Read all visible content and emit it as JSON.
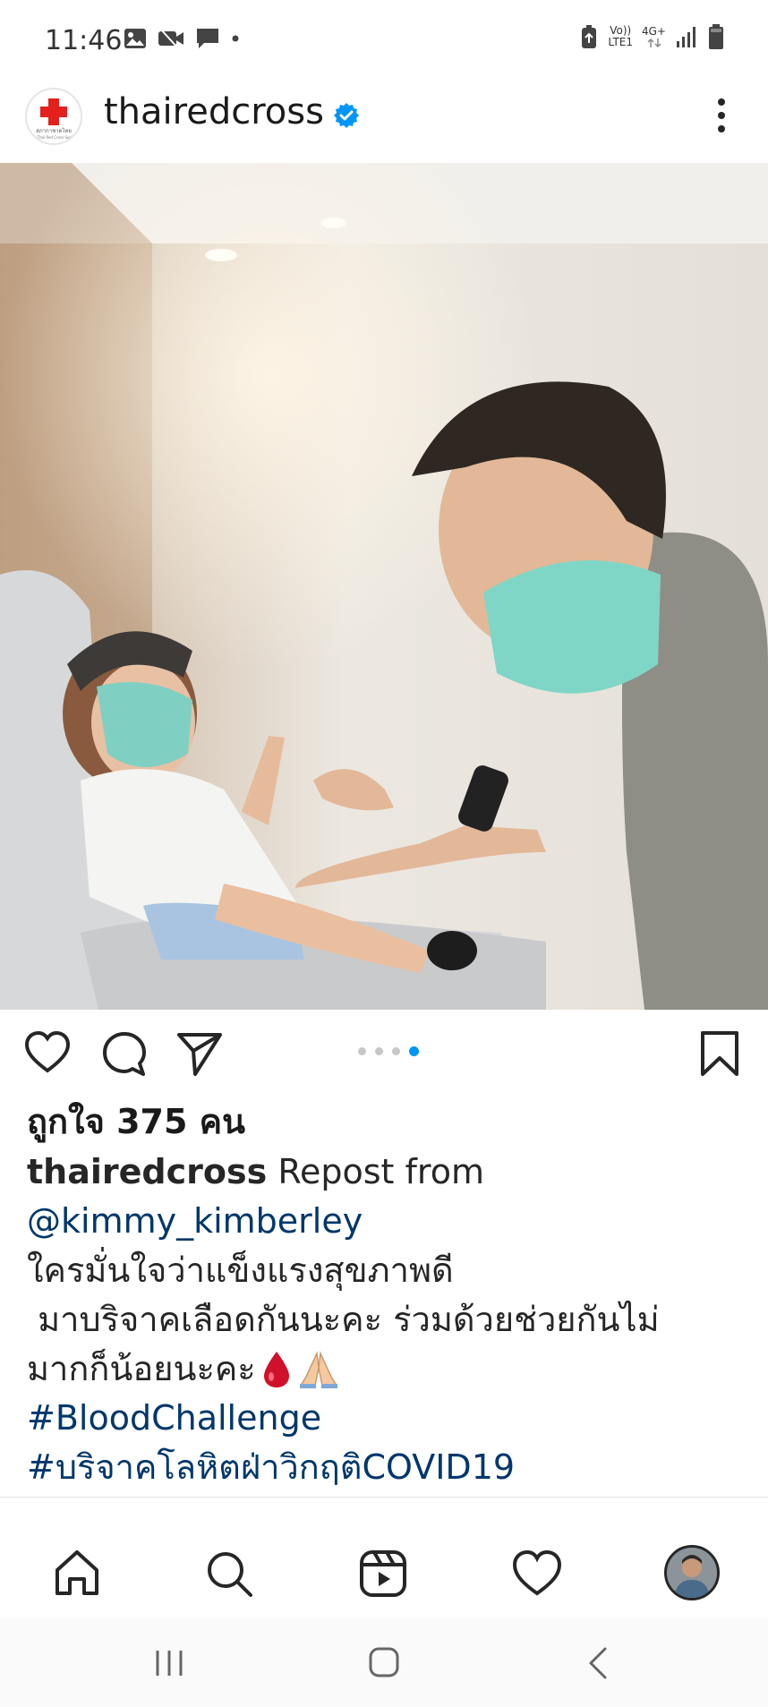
{
  "status_bar": {
    "time": "11:46",
    "network_top": "Vo))",
    "network_bottom": "LTE1",
    "network_type": "4G+",
    "left_icons": [
      "gallery-icon",
      "video-off-icon",
      "message-icon",
      "dot-icon"
    ],
    "right_icons": [
      "battery-saver-icon",
      "signal-icon",
      "battery-icon"
    ]
  },
  "header": {
    "username": "thairedcross",
    "verified": true,
    "avatar_text": "สภากาชาดไทย",
    "avatar_subtext": "The Thai Red Cross Society"
  },
  "post": {
    "carousel": {
      "count": 4,
      "active_index": 3
    },
    "likes": "ถูกใจ 375 คน",
    "caption": {
      "username": "thairedcross",
      "prefix": "Repost from",
      "mention": "@kimmy_kimberley",
      "line1": "ใครมั่นใจว่าแข็งแรงสุขภาพดี",
      "line2": " มาบริจาคเลือดกันนะคะ ร่วมด้วยช่วยกันไม่",
      "line3": "มากก็น้อยนะคะ",
      "emojis": [
        "drop-of-blood",
        "folded-hands"
      ],
      "hashtag1": "#BloodChallenge",
      "hashtag2": "#บริจาคโลหิตฝ่าวิกฤติCOVID19"
    }
  },
  "colors": {
    "accent_blue": "#0095f6",
    "link_blue": "#00376b",
    "red_cross": "#e3201b",
    "text": "#262626"
  },
  "bottom_nav": [
    "home-icon",
    "search-icon",
    "reels-icon",
    "activity-icon",
    "profile-avatar"
  ],
  "system_nav": [
    "recent-apps-icon",
    "home-button-icon",
    "back-icon"
  ]
}
